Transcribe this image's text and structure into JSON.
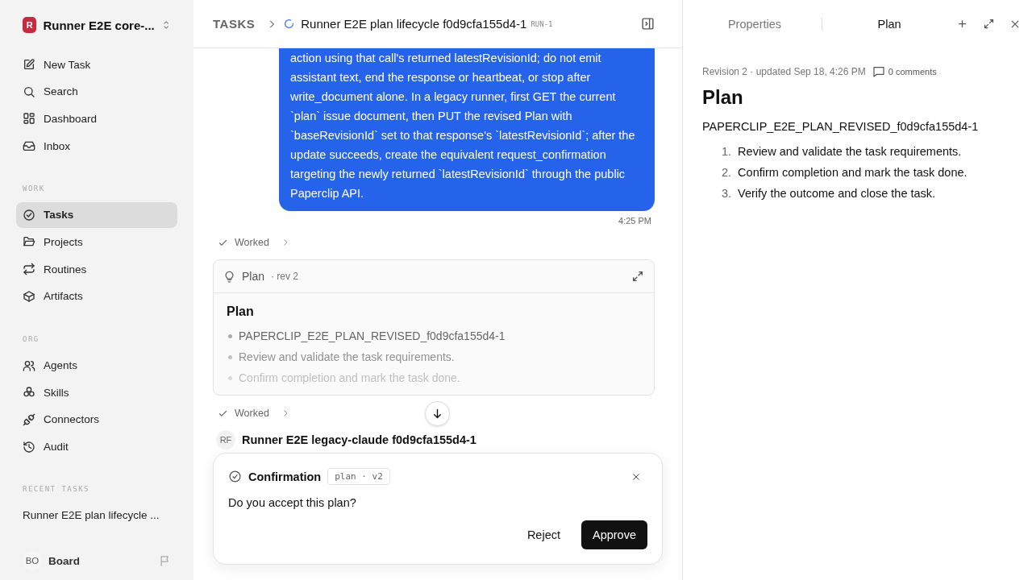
{
  "workspace": {
    "initial": "R",
    "name": "Runner E2E core-..."
  },
  "nav": [
    {
      "label": "New Task",
      "selected": false
    },
    {
      "label": "Search",
      "selected": false
    },
    {
      "label": "Dashboard",
      "selected": false
    },
    {
      "label": "Inbox",
      "selected": false
    }
  ],
  "sections": [
    {
      "heading": "WORK",
      "items": [
        {
          "label": "Tasks",
          "selected": true
        },
        {
          "label": "Projects",
          "selected": false
        },
        {
          "label": "Routines",
          "selected": false
        },
        {
          "label": "Artifacts",
          "selected": false
        }
      ]
    },
    {
      "heading": "ORG",
      "items": [
        {
          "label": "Agents",
          "selected": false
        },
        {
          "label": "Skills",
          "selected": false
        },
        {
          "label": "Connectors",
          "selected": false
        },
        {
          "label": "Audit",
          "selected": false
        }
      ]
    }
  ],
  "recent": {
    "heading": "RECENT TASKS",
    "items": [
      "Runner E2E plan lifecycle ..."
    ]
  },
  "user": {
    "initials": "BO",
    "name": "Board"
  },
  "breadcrumb": {
    "root": "TASKS",
    "title": "Runner E2E plan lifecycle f0d9cfa155d4-1",
    "run": "RUN-1"
  },
  "message": {
    "text": "action using that call's returned latestRevisionId; do not emit assistant text, end the response or heartbeat, or stop after write_document alone. In a legacy runner, first GET the current `plan` issue document, then PUT the revised Plan with `baseRevisionId` set to that response's `latestRevisionId`; after the update succeeds, create the equivalent request_confirmation targeting the newly returned `latestRevisionId` through the public Paperclip API.",
    "time": "4:25 PM"
  },
  "worked_top": "Worked",
  "plan_card": {
    "label": "Plan",
    "rev": "· rev 2",
    "heading": "Plan",
    "bullets": [
      "PAPERCLIP_E2E_PLAN_REVISED_f0d9cfa155d4-1",
      "Review and validate the task requirements.",
      "Confirm completion and mark the task done."
    ]
  },
  "worked_bottom": "Worked",
  "agent": {
    "initials": "RF",
    "name": "Runner E2E legacy-claude f0d9cfa155d4-1"
  },
  "confirmation": {
    "title": "Confirmation",
    "tag": "plan · v2",
    "question": "Do you accept this plan?",
    "buttons": [
      {
        "label": "Reject",
        "kind": "secondary"
      },
      {
        "label": "Approve",
        "kind": "primary"
      }
    ]
  },
  "panel": {
    "tabs": [
      {
        "label": "Properties",
        "selected": false
      },
      {
        "label": "Plan",
        "selected": true
      }
    ],
    "meta": "Revision 2 · updated Sep 18, 4:26 PM",
    "comments": "0 comments",
    "title": "Plan",
    "code": "PAPERCLIP_E2E_PLAN_REVISED_f0d9cfa155d4-1",
    "steps": [
      {
        "number": "1.",
        "text": "Review and validate the task requirements."
      },
      {
        "number": "2.",
        "text": "Confirm completion and mark the task done."
      },
      {
        "number": "3.",
        "text": "Verify the outcome and close the task."
      }
    ]
  }
}
